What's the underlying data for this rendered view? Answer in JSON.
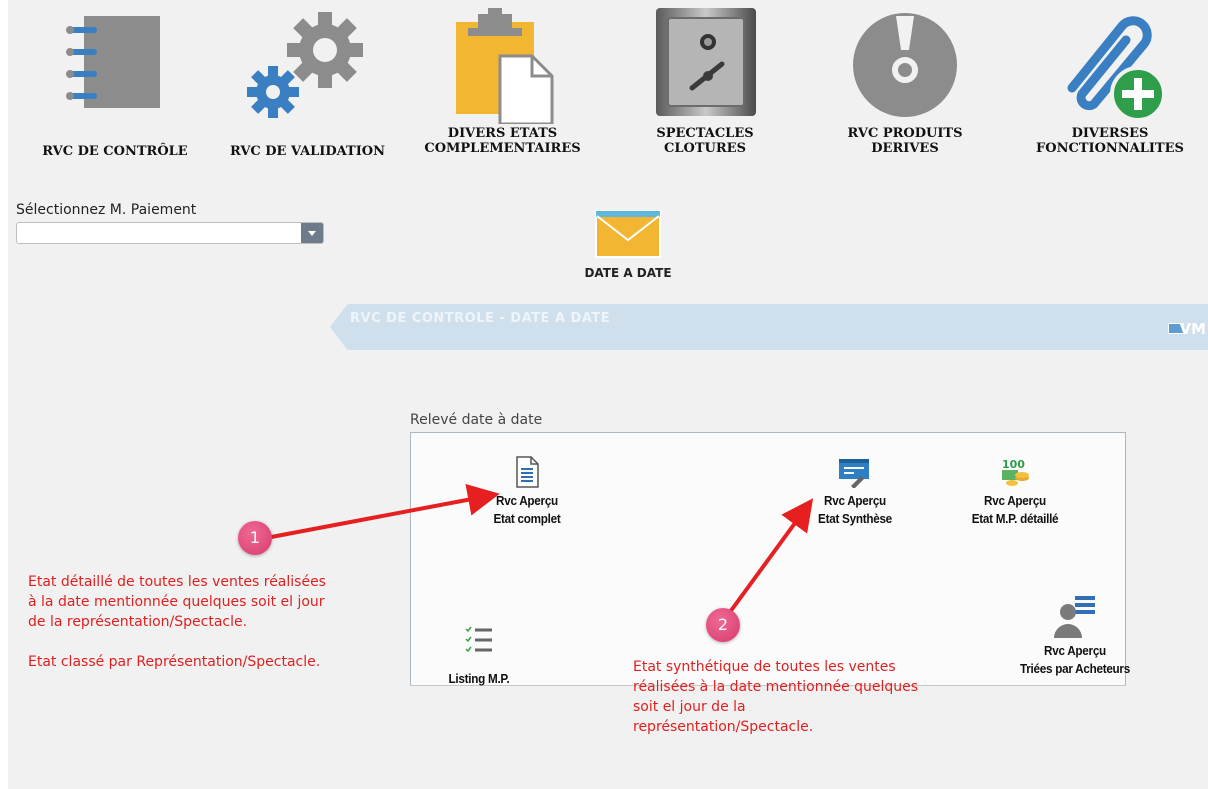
{
  "toolbar": {
    "items": [
      {
        "label": "RVC DE CONTRÔLE",
        "icon": "notebook-icon"
      },
      {
        "label": "RVC DE VALIDATION",
        "icon": "gears-icon"
      },
      {
        "label": "DIVERS ETATS\nCOMPLEMENTAIRES",
        "icon": "clipboard-icon"
      },
      {
        "label": "SPECTACLES\nCLOTURES",
        "icon": "safe-icon"
      },
      {
        "label": "RVC PRODUITS\nDERIVES",
        "icon": "disc-icon"
      },
      {
        "label": "DIVERSES\nFONCTIONNALITES",
        "icon": "paperclip-add-icon"
      }
    ]
  },
  "payment_select": {
    "label": "Sélectionnez M. Paiement",
    "value": ""
  },
  "date_a_date": {
    "label": "DATE A DATE",
    "icon": "envelope-icon"
  },
  "banner": {
    "title": "RVC DE CONTROLE - DATE A DATE",
    "right_text": "VM"
  },
  "releve": {
    "title": "Relevé date à date",
    "items": [
      {
        "line1": "Rvc Aperçu",
        "line2": "Etat complet",
        "icon": "document-icon"
      },
      {
        "line1": "Rvc Aperçu",
        "line2": "Etat Synthèse",
        "icon": "report-edit-icon"
      },
      {
        "line1": "Rvc Aperçu",
        "line2": "Etat M.P. détaillé",
        "icon": "money-icon"
      },
      {
        "line1": "Listing M.P.",
        "line2": "",
        "icon": "checklist-icon"
      },
      {
        "line1": "Rvc Aperçu",
        "line2": "Triées par Acheteurs",
        "icon": "user-list-icon"
      }
    ]
  },
  "annotations": {
    "marker1": "1",
    "marker2": "2",
    "note1": "Etat détaillé de toutes les ventes réalisées\nà la date mentionnée quelques soit el jour\nde la représentation/Spectacle.\n\nEtat classé par Représentation/Spectacle.",
    "note2": "Etat synthétique de toutes les ventes\nréalisées à la date mentionnée quelques\nsoit el jour de la\nreprésentation/Spectacle.",
    "color": "#e02020"
  },
  "colors": {
    "background": "#f1f1f1",
    "banner": "#cfe0ec",
    "icon_grey": "#8c8c8c",
    "icon_blue": "#3a7fc1",
    "icon_yellow": "#f2b632",
    "icon_green": "#2e9e4a"
  }
}
